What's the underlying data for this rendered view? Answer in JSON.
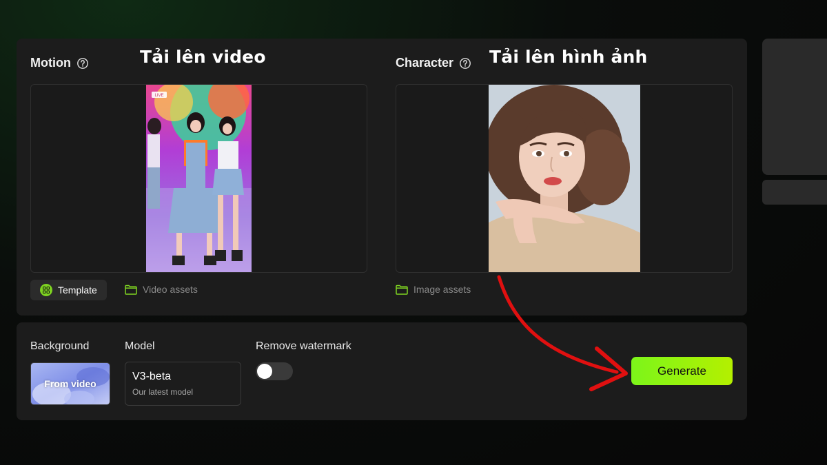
{
  "motion": {
    "label": "Motion",
    "annotation": "Tải lên video",
    "template_label": "Template",
    "assets_label": "Video assets",
    "thumb_badge": "LIVE"
  },
  "character": {
    "label": "Character",
    "annotation": "Tải lên hình ảnh",
    "assets_label": "Image assets"
  },
  "settings": {
    "background_label": "Background",
    "background_value": "From video",
    "model_label": "Model",
    "model_name": "V3-beta",
    "model_description": "Our latest model",
    "watermark_label": "Remove watermark",
    "watermark_enabled": false
  },
  "generate_label": "Generate",
  "colors": {
    "accent": "#7ed321",
    "generate_start": "#7cf51a",
    "generate_end": "#b4f000",
    "arrow": "#e01010",
    "panel": "#1c1c1c"
  },
  "icons": {
    "help": "question-circle-icon",
    "folder": "folder-icon",
    "template": "grid-icon",
    "arrow": "curved-red-arrow"
  }
}
